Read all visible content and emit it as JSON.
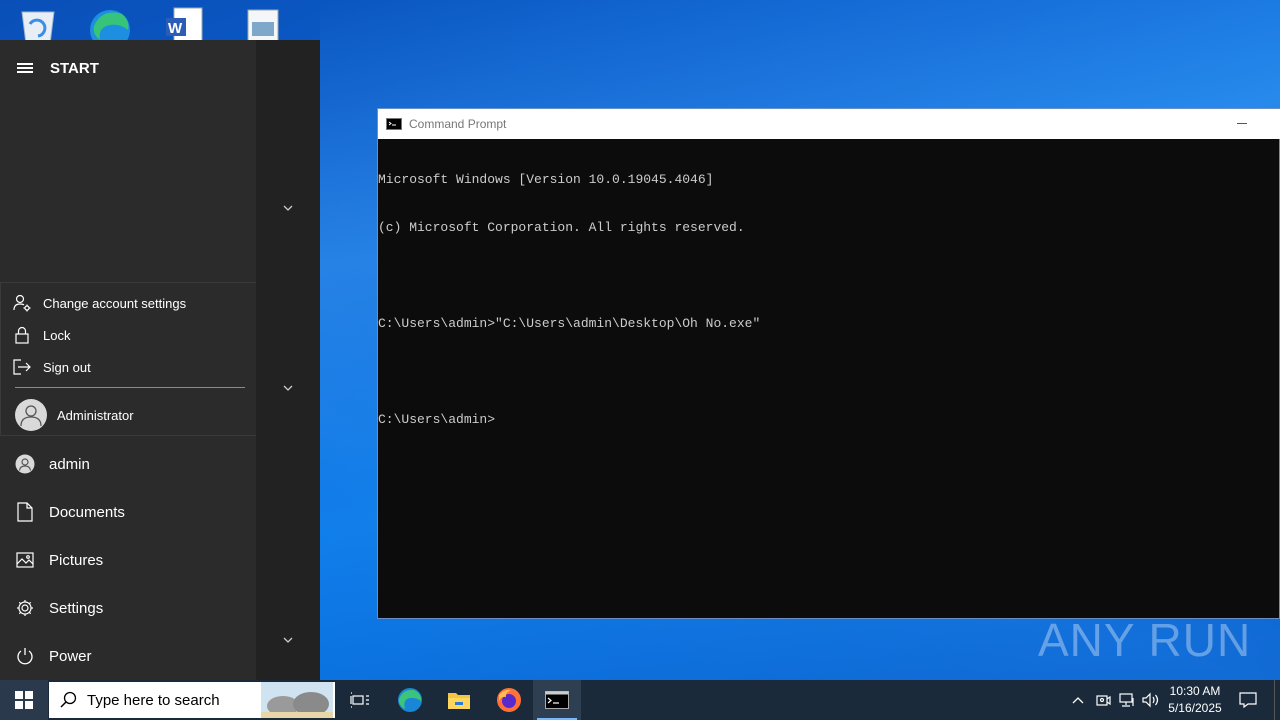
{
  "desktop": {
    "icons": [
      "recycle-bin",
      "microsoft-edge",
      "word-document",
      "image-file"
    ]
  },
  "start_menu": {
    "title": "START",
    "account_flyout": {
      "items": [
        {
          "label": "Change account settings",
          "icon": "person-gear-icon"
        },
        {
          "label": "Lock",
          "icon": "lock-icon"
        },
        {
          "label": "Sign out",
          "icon": "sign-out-icon"
        }
      ],
      "user": "Administrator"
    },
    "items": [
      {
        "label": "admin",
        "icon": "user-icon"
      },
      {
        "label": "Documents",
        "icon": "document-icon"
      },
      {
        "label": "Pictures",
        "icon": "pictures-icon"
      },
      {
        "label": "Settings",
        "icon": "gear-icon"
      },
      {
        "label": "Power",
        "icon": "power-icon"
      }
    ]
  },
  "cmd_window": {
    "title": "Command Prompt",
    "lines": [
      "Microsoft Windows [Version 10.0.19045.4046]",
      "(c) Microsoft Corporation. All rights reserved.",
      "",
      "C:\\Users\\admin>\"C:\\Users\\admin\\Desktop\\Oh No.exe\"",
      "",
      "C:\\Users\\admin>"
    ]
  },
  "watermark": "ANY RUN",
  "taskbar": {
    "search_placeholder": "Type here to search",
    "pinned": [
      "task-view",
      "microsoft-edge",
      "file-explorer",
      "firefox",
      "command-prompt"
    ],
    "active": "command-prompt",
    "clock": {
      "time": "10:30 AM",
      "date": "5/16/2025"
    }
  },
  "colors": {
    "start_bg": "#2b2b2b",
    "taskbar_bg": "#1b2a3b",
    "console_bg": "#0c0c0c",
    "console_text": "#cccccc"
  }
}
